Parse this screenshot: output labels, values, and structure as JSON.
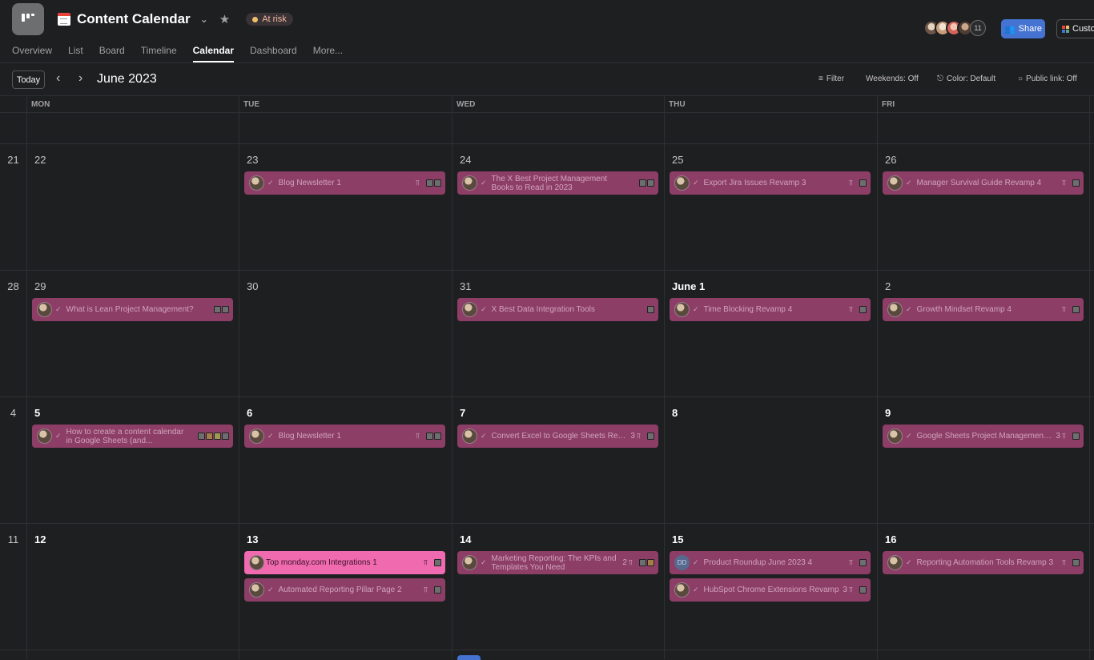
{
  "header": {
    "title": "Content Calendar",
    "status": "At risk",
    "member_count": "11",
    "share_label": "Share",
    "customize_label": "Custo"
  },
  "tabs": [
    "Overview",
    "List",
    "Board",
    "Timeline",
    "Calendar",
    "Dashboard",
    "More..."
  ],
  "active_tab": "Calendar",
  "toolbar": {
    "today": "Today",
    "month": "June 2023",
    "filter": "Filter",
    "weekends": "Weekends: Off",
    "color": "Color: Default",
    "public_link": "Public link: Off"
  },
  "weekdays": [
    "MON",
    "TUE",
    "WED",
    "THU",
    "FRI"
  ],
  "weeks": [
    {
      "num": "",
      "days": [
        "",
        "",
        "",
        "",
        ""
      ]
    },
    {
      "num": "21",
      "days": [
        "22",
        "23",
        "24",
        "25",
        "26"
      ]
    },
    {
      "num": "28",
      "days": [
        "29",
        "30",
        "31",
        "June 1",
        "2"
      ]
    },
    {
      "num": "4",
      "days": [
        "5",
        "6",
        "7",
        "8",
        "9"
      ]
    },
    {
      "num": "11",
      "days": [
        "12",
        "13",
        "14",
        "15",
        "16"
      ]
    }
  ],
  "tasks": [
    {
      "week": 1,
      "day": 1,
      "slot": 0,
      "name": "Blog Newsletter 1",
      "meta": "",
      "sub": true,
      "squares": [
        "g",
        "g"
      ]
    },
    {
      "week": 1,
      "day": 2,
      "slot": 0,
      "name": "The X Best Project Management Books to Read in 2023",
      "meta": "",
      "sub": false,
      "squares": [
        "g",
        "g"
      ]
    },
    {
      "week": 1,
      "day": 3,
      "slot": 0,
      "name": "Export Jira Issues Revamp 3",
      "meta": "",
      "sub": true,
      "squares": [
        "g"
      ]
    },
    {
      "week": 1,
      "day": 4,
      "slot": 0,
      "name": "Manager Survival Guide Revamp 4",
      "meta": "",
      "sub": true,
      "squares": [
        "g"
      ]
    },
    {
      "week": 2,
      "day": 0,
      "slot": 0,
      "name": "What is Lean Project Management?",
      "meta": "",
      "sub": false,
      "squares": [
        "g",
        "g"
      ]
    },
    {
      "week": 2,
      "day": 2,
      "slot": 0,
      "name": "X Best Data Integration Tools",
      "meta": "",
      "sub": false,
      "squares": [
        "g"
      ]
    },
    {
      "week": 2,
      "day": 3,
      "slot": 0,
      "name": "Time Blocking Revamp 4",
      "meta": "",
      "sub": true,
      "squares": [
        "g"
      ]
    },
    {
      "week": 2,
      "day": 4,
      "slot": 0,
      "name": "Growth Mindset Revamp 4",
      "meta": "",
      "sub": true,
      "squares": [
        "g"
      ]
    },
    {
      "week": 3,
      "day": 0,
      "slot": 0,
      "name": "How to create a content calendar in Google Sheets (and...",
      "meta": "",
      "sub": false,
      "squares": [
        "g",
        "o",
        "y",
        "g"
      ]
    },
    {
      "week": 3,
      "day": 1,
      "slot": 0,
      "name": "Blog Newsletter 1",
      "meta": "",
      "sub": true,
      "squares": [
        "g",
        "g"
      ]
    },
    {
      "week": 3,
      "day": 2,
      "slot": 0,
      "name": "Convert Excel to Google Sheets Revamp",
      "meta": "3",
      "sub": true,
      "squares": [
        "g"
      ]
    },
    {
      "week": 3,
      "day": 4,
      "slot": 0,
      "name": "Google Sheets Project Management Revamp",
      "meta": "3",
      "sub": true,
      "squares": [
        "g"
      ]
    },
    {
      "week": 4,
      "day": 1,
      "slot": 0,
      "name": "Top monday.com Integrations 1",
      "meta": "",
      "sub": true,
      "squares": [
        "g"
      ],
      "bright": true
    },
    {
      "week": 4,
      "day": 1,
      "slot": 1,
      "name": "Automated Reporting Pillar Page 2",
      "meta": "",
      "sub": true,
      "squares": [
        "g"
      ]
    },
    {
      "week": 4,
      "day": 2,
      "slot": 0,
      "name": "Marketing Reporting: The KPIs and Templates You Need",
      "meta": "2",
      "sub": true,
      "squares": [
        "g",
        "o"
      ]
    },
    {
      "week": 4,
      "day": 3,
      "slot": 0,
      "name": "Product Roundup June 2023 4",
      "meta": "",
      "sub": true,
      "squares": [
        "g"
      ],
      "avatar": "DD"
    },
    {
      "week": 4,
      "day": 3,
      "slot": 1,
      "name": "HubSpot Chrome Extensions Revamp",
      "meta": "3",
      "sub": true,
      "squares": [
        "g"
      ]
    },
    {
      "week": 4,
      "day": 4,
      "slot": 0,
      "name": "Reporting Automation Tools Revamp 3",
      "meta": "",
      "sub": true,
      "squares": [
        "g"
      ]
    }
  ]
}
